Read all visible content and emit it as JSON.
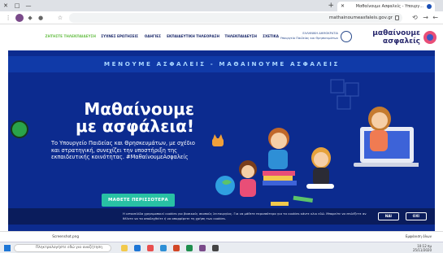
{
  "browser": {
    "tab_title": "Μαθαίνουμε Ασφαλείς - Υπουργ...",
    "url": "mathainoumeasfaleis.gov.gr"
  },
  "site": {
    "logo_line1": "μαθαίνουμε",
    "logo_line2": "ασφαλείς",
    "ministry_line1": "ΕΛΛΗΝΙΚΗ ΔΗΜΟΚΡΑΤΙΑ",
    "ministry_line2": "Υπουργείο Παιδείας και Θρησκευμάτων",
    "nav": [
      "ΣΧΕΤΙΚΑ",
      "ΤΗΛΕΚΠΑΙΔΕΥΣΗ",
      "ΕΚΠΑΙΔΕΥΤΙΚΗ ΤΗΛΕΟΡΑΣΗ",
      "ΟΔΗΓΙΕΣ",
      "ΣΥΧΝΕΣ ΕΡΩΤΗΣΕΙΣ",
      "ΖΗΤΗΣΤΕ ΤΗΛΕΚΠΑΙΔΕΥΣΗ"
    ]
  },
  "hero": {
    "band": "ΜΕΝΟΥΜΕ ΑΣΦΑΛΕΙΣ - ΜΑΘΑΙΝΟΥΜΕ ΑΣΦΑΛΕΙΣ",
    "title_line1": "Μαθαίνουμε",
    "title_line2": "με ασφάλεια!",
    "text": "Το Υπουργείο Παιδείας και Θρησκευμάτων, με σχέδιο και στρατηγική, συνεχίζει την υποστήριξη της εκπαιδευτικής κοινότητας. #ΜαθαίνουμεΑσφαλείς",
    "cta": "ΜΑΘΕΤΕ ΠΕΡΙΣΣΟΤΕΡΑ"
  },
  "cookie": {
    "text": "Η ιστοσελίδα χρησιμοποιεί cookies για βασικούς σκοπούς λειτουργίας. Για να μάθετε περισσότερα για τα cookies κάντε κλικ εδώ. Μπορείτε να επιλέξετε αν θέλετε να τα αποδεχθείτε ή να απορρίψετε τη χρήση των cookies.",
    "accept": "ΝΑΙ",
    "reject": "ΟΧΙ"
  },
  "downloads": {
    "item": "Screenshot.png",
    "show_all": "Εμφάνιση όλων"
  },
  "taskbar": {
    "search_placeholder": "Πληκτρολογήστε εδώ για αναζήτηση",
    "time": "10:12 πμ",
    "date": "25/11/2020"
  },
  "colors": {
    "hero_bg": "#0c2b8f",
    "cta": "#28c1a4",
    "accent_green": "#6bc04b"
  }
}
